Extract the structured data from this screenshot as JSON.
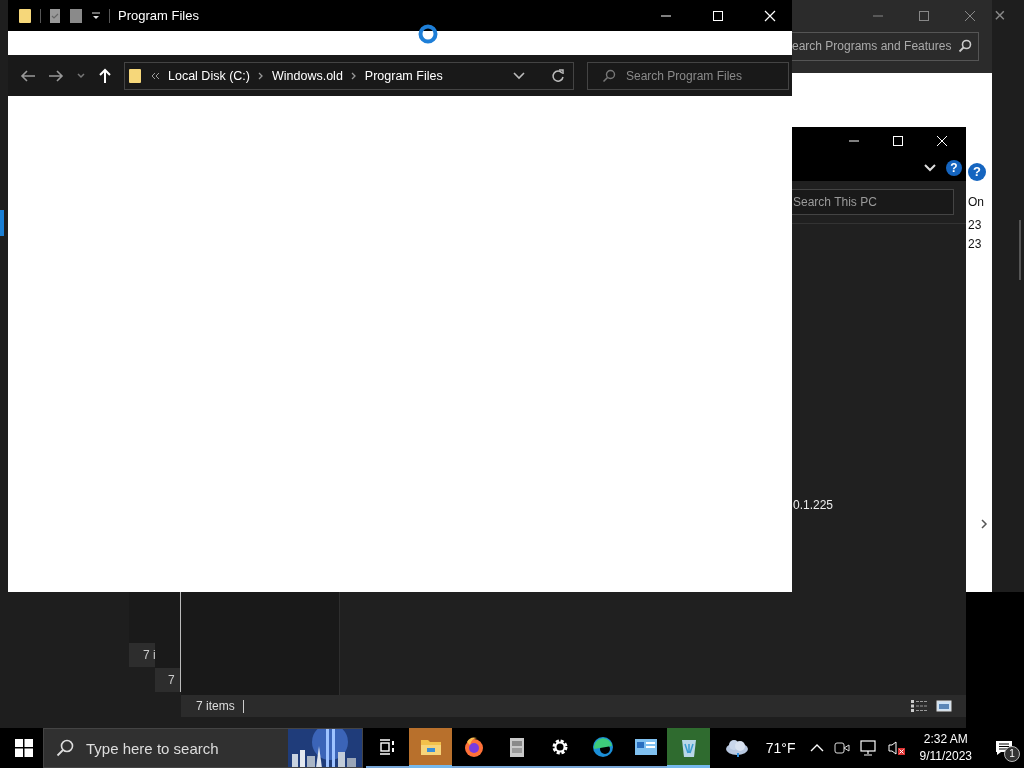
{
  "programs_window": {
    "search_placeholder": "earch Programs and Features",
    "help": "?",
    "column_header": "On",
    "cells": [
      "23",
      "23"
    ]
  },
  "outer_close": "×",
  "this_pc_window": {
    "help": "?",
    "search_placeholder": "Search This PC",
    "row_text": "0.1.225",
    "status": "7 items"
  },
  "stacked_windows": [
    {
      "status": "7 i"
    },
    {
      "status": "7"
    }
  ],
  "explorer": {
    "title": "Program Files",
    "loading": true,
    "breadcrumbs": [
      "Local Disk (C:)",
      "Windows.old",
      "Program Files"
    ],
    "search_placeholder": "Search Program Files"
  },
  "taskbar": {
    "search_placeholder": "Type here to search",
    "apps": [
      {
        "kind": "task-view",
        "active": false
      },
      {
        "kind": "explorer",
        "active": true
      },
      {
        "kind": "firefox",
        "active": false
      },
      {
        "kind": "archive",
        "active": false
      },
      {
        "kind": "settings",
        "active": false
      },
      {
        "kind": "edge",
        "active": false
      },
      {
        "kind": "control-panel",
        "active": false
      },
      {
        "kind": "recycle",
        "active": true
      }
    ],
    "weather": "71°F",
    "volume_muted": true,
    "time": "2:32 AM",
    "date": "9/11/2023",
    "notifications": "1"
  }
}
